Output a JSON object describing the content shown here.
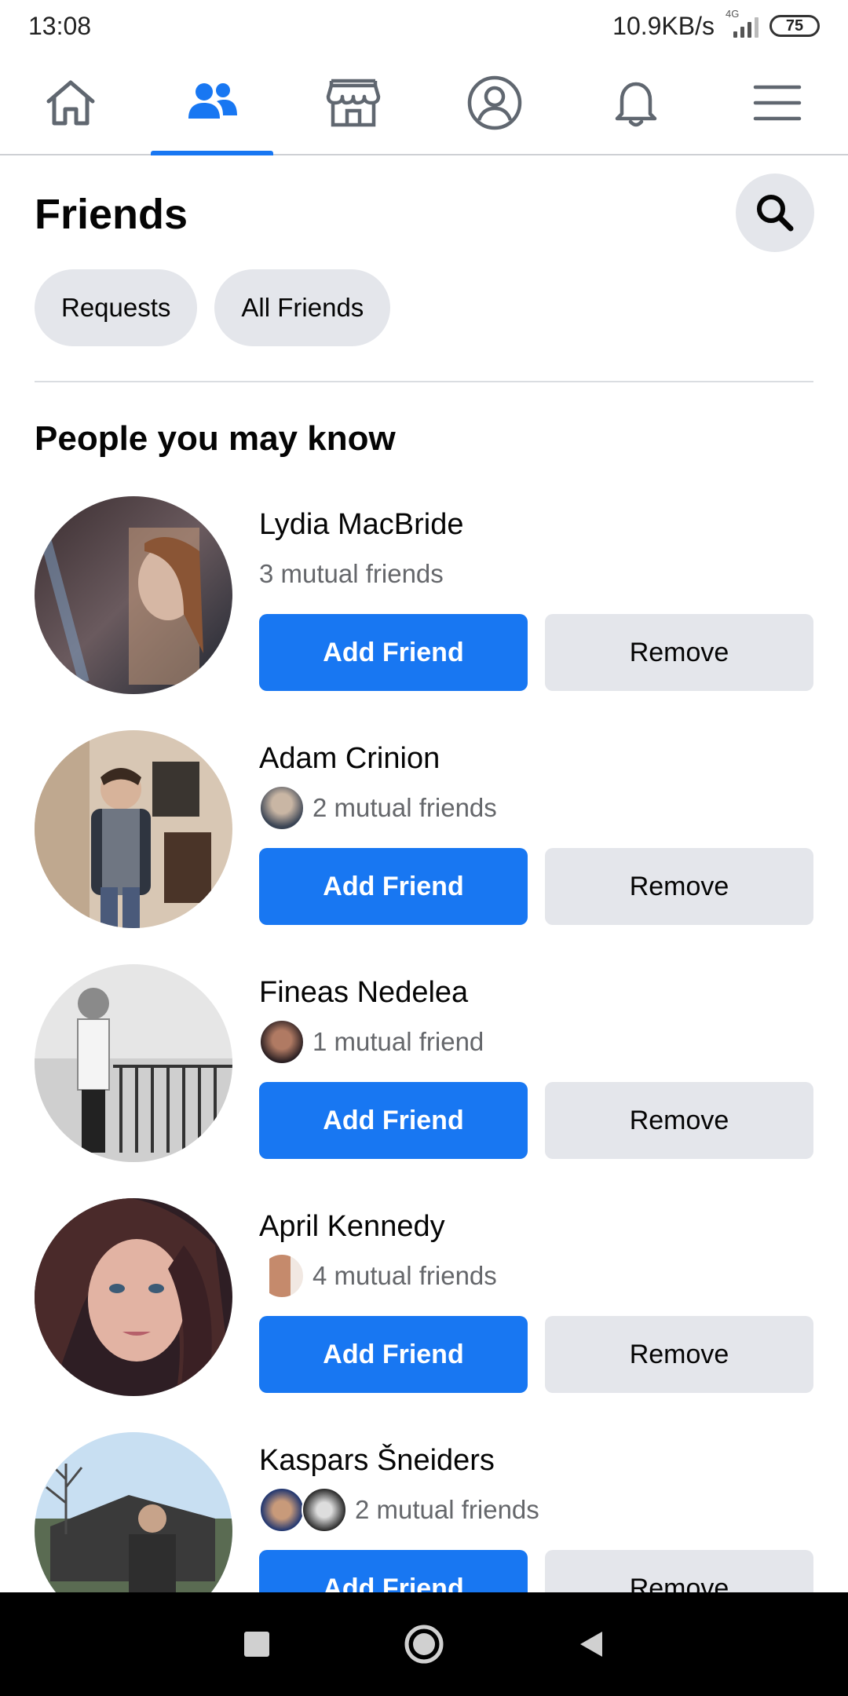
{
  "status_bar": {
    "time": "13:08",
    "speed": "10.9KB/s",
    "network": "4G",
    "battery": "75"
  },
  "nav": {
    "tabs": [
      "home-icon",
      "friends-icon",
      "marketplace-icon",
      "profile-icon",
      "notifications-icon",
      "menu-icon"
    ],
    "active_tab": "friends-icon",
    "accent_color": "#1877f2"
  },
  "page": {
    "title": "Friends",
    "search_icon": "search-icon",
    "chips": [
      "Requests",
      "All Friends"
    ],
    "section_title": "People you may know"
  },
  "suggestions": [
    {
      "name": "Lydia MacBride",
      "mutual": "3 mutual friends",
      "mutual_avatars": 0
    },
    {
      "name": "Adam Crinion",
      "mutual": "2 mutual friends",
      "mutual_avatars": 1
    },
    {
      "name": "Fineas Nedelea",
      "mutual": "1 mutual friend",
      "mutual_avatars": 1
    },
    {
      "name": "April Kennedy",
      "mutual": "4 mutual friends",
      "mutual_avatars": 1
    },
    {
      "name": "Kaspars Šneiders",
      "mutual": "2 mutual friends",
      "mutual_avatars": 2
    }
  ],
  "buttons": {
    "add": "Add Friend",
    "remove": "Remove"
  },
  "system_nav": [
    "recents-icon",
    "home-circle-icon",
    "back-icon"
  ]
}
